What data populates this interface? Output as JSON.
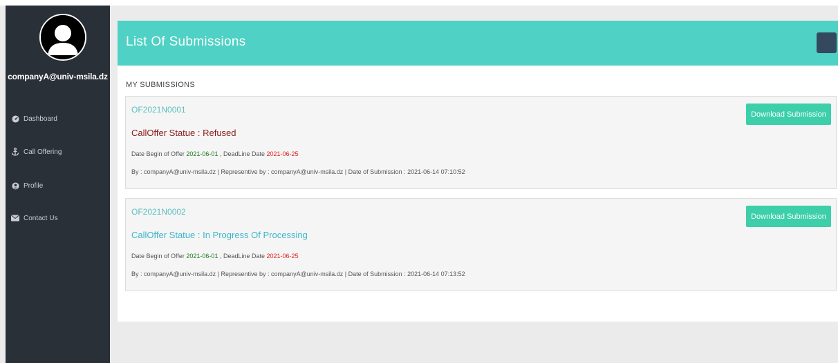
{
  "user": {
    "email": "companyA@univ-msila.dz"
  },
  "sidebar": {
    "items": [
      {
        "label": "Dashboard",
        "icon": "dashboard-icon"
      },
      {
        "label": "Call Offering",
        "icon": "anchor-icon"
      },
      {
        "label": "Profile",
        "icon": "user-circle-icon"
      },
      {
        "label": "Contact Us",
        "icon": "envelope-icon"
      }
    ]
  },
  "header": {
    "title": "List Of Submissions"
  },
  "section": {
    "title": "MY SUBMISSIONS"
  },
  "submissions": [
    {
      "code": "OF2021N0001",
      "status": "CallOffer Statue : Refused",
      "status_color": "#8b1a1a",
      "date_begin_label": "Date Begin of Offer",
      "date_begin": "2021-06-01",
      "deadline_label": ", DeadLine Date",
      "deadline": "2021-06-25",
      "meta": "By : companyA@univ-msila.dz | Representive by : companyA@univ-msila.dz | Date of Submission : 2021-06-14 07:10:52",
      "button": "Download Submission"
    },
    {
      "code": "OF2021N0002",
      "status": "CallOffer Statue : In Progress Of Processing",
      "status_color": "#3ab7c9",
      "date_begin_label": "Date Begin of Offer",
      "date_begin": "2021-06-01",
      "deadline_label": ", DeadLine Date",
      "deadline": "2021-06-25",
      "meta": "By : companyA@univ-msila.dz | Representive by : companyA@univ-msila.dz | Date of Submission : 2021-06-14 07:13:52",
      "button": "Download Submission"
    }
  ],
  "colors": {
    "sidebar_bg": "#2a3038",
    "header_bg": "#4fd1c5",
    "button_bg": "#3ccfa9"
  }
}
